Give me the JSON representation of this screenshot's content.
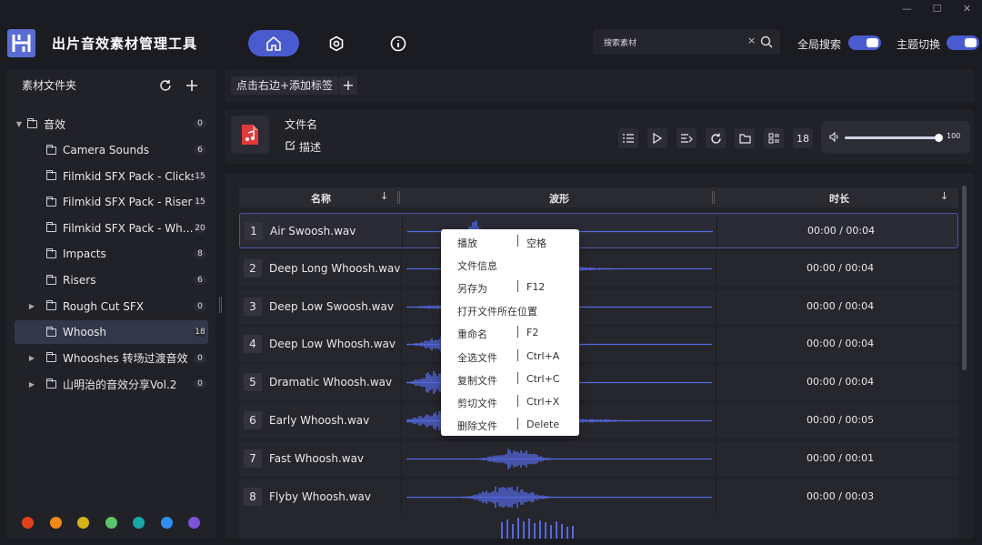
{
  "window": {
    "minimize": "—",
    "maximize": "☐",
    "close": "✕"
  },
  "app": {
    "title": "出片音效素材管理工具",
    "accent": "#4a5bd0"
  },
  "nav": [
    "home-icon",
    "settings-icon",
    "info-icon"
  ],
  "search": {
    "value": "搜索素材",
    "clear": "×"
  },
  "toggles": {
    "global_search": "全局搜索",
    "theme": "主题切换"
  },
  "sidebar": {
    "title": "素材文件夹",
    "root": {
      "label": "音效",
      "count": "0"
    },
    "items": [
      {
        "label": "Camera Sounds",
        "count": "6",
        "expandable": false
      },
      {
        "label": "Filmkid SFX Pack - Clicks",
        "count": "15",
        "expandable": false
      },
      {
        "label": "Filmkid SFX Pack - Riser",
        "count": "15",
        "expandable": false
      },
      {
        "label": "Filmkid SFX Pack - Wh…",
        "count": "20",
        "expandable": false
      },
      {
        "label": "Impacts",
        "count": "8",
        "expandable": false
      },
      {
        "label": "Risers",
        "count": "6",
        "expandable": false
      },
      {
        "label": "Rough Cut SFX",
        "count": "0",
        "expandable": true
      },
      {
        "label": "Whoosh",
        "count": "18",
        "expandable": false,
        "selected": true
      },
      {
        "label": "Whooshes 转场过渡音效",
        "count": "0",
        "expandable": true
      },
      {
        "label": "山明治的音效分享Vol.2",
        "count": "0",
        "expandable": true
      }
    ],
    "color_tags": [
      "#e0421b",
      "#f08a16",
      "#d6b21a",
      "#5cc46a",
      "#17a8a8",
      "#2f8ff0",
      "#7a55d6"
    ]
  },
  "tags": {
    "chip": "点击右边+添加标签",
    "add": "+"
  },
  "player": {
    "file_name_label": "文件名",
    "desc_label": "描述",
    "count": "18",
    "volume": "100",
    "volume_level": 0.96
  },
  "table": {
    "headers": {
      "name": "名称",
      "wave": "波形",
      "duration": "时长"
    },
    "rows": [
      {
        "num": "1",
        "name": "Air Swoosh.wav",
        "duration": "00:00 / 00:04"
      },
      {
        "num": "2",
        "name": "Deep Long Whoosh.wav",
        "duration": "00:00 / 00:04"
      },
      {
        "num": "3",
        "name": "Deep Low Swoosh.wav",
        "duration": "00:00 / 00:04"
      },
      {
        "num": "4",
        "name": "Deep Low Whoosh.wav",
        "duration": "00:00 / 00:04"
      },
      {
        "num": "5",
        "name": "Dramatic Whoosh.wav",
        "duration": "00:00 / 00:04"
      },
      {
        "num": "6",
        "name": "Early Whoosh.wav",
        "duration": "00:00 / 00:05"
      },
      {
        "num": "7",
        "name": "Fast Whoosh.wav",
        "duration": "00:00 / 00:01"
      },
      {
        "num": "8",
        "name": "Flyby Whoosh.wav",
        "duration": "00:00 / 00:03"
      }
    ]
  },
  "context_menu": [
    {
      "action": "播放",
      "key": "空格"
    },
    {
      "action": "文件信息",
      "key": ""
    },
    {
      "action": "另存为",
      "key": "F12"
    },
    {
      "action": "打开文件所在位置",
      "key": ""
    },
    {
      "action": "重命名",
      "key": "F2"
    },
    {
      "action": "全选文件",
      "key": "Ctrl+A"
    },
    {
      "action": "复制文件",
      "key": "Ctrl+C"
    },
    {
      "action": "剪切文件",
      "key": "Ctrl+X"
    },
    {
      "action": "删除文件",
      "key": "Delete"
    }
  ]
}
